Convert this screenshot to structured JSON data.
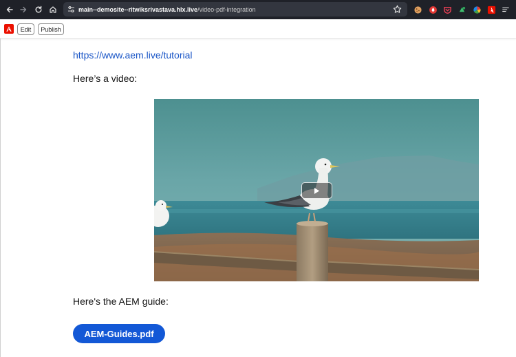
{
  "browser": {
    "url_host": "main--demosite--ritwiksrivastava.hlx.live",
    "url_path": "/video-pdf-integration",
    "icons": [
      "back-icon",
      "forward-icon",
      "reload-icon",
      "home-icon",
      "site-info-icon",
      "bookmark-star-icon"
    ],
    "extensions": [
      "cookie-extension-icon",
      "red-extension-icon",
      "pocket-extension-icon",
      "green-extension-icon",
      "color-extension-icon",
      "adobe-extension-icon",
      "menu-icon"
    ]
  },
  "sidekick": {
    "logo_icon": "adobe-logo-icon",
    "edit_label": "Edit",
    "publish_label": "Publish"
  },
  "content": {
    "link_text": "https://www.aem.live/tutorial",
    "video_intro": "Here’s a video:",
    "video_play_icon": "play-icon",
    "guide_intro": "Here's the AEM guide:",
    "pdf_button_label": "AEM-Guides.pdf"
  },
  "colors": {
    "link": "#1a56c7",
    "button": "#1358d6",
    "adobe_red": "#eb1000",
    "chrome_bg": "#1f2128"
  }
}
